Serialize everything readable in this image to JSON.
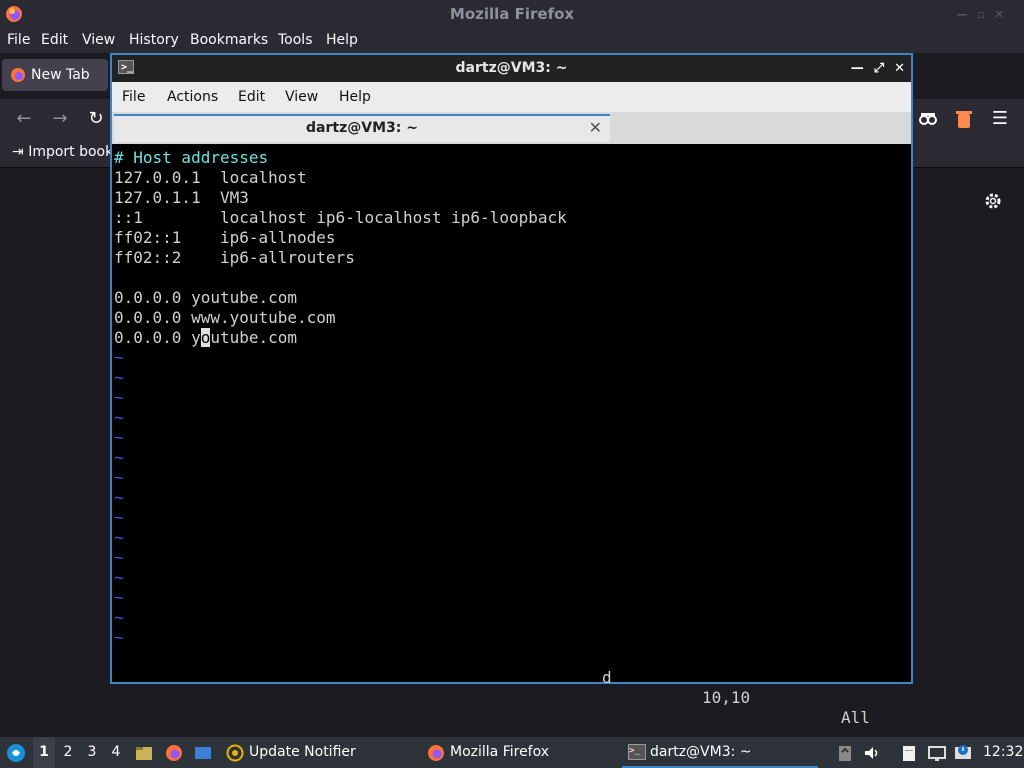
{
  "firefox": {
    "window_title": "Mozilla Firefox",
    "menu": [
      "File",
      "Edit",
      "View",
      "History",
      "Bookmarks",
      "Tools",
      "Help"
    ],
    "tab_label": "New Tab",
    "bookmark_label": "Import book"
  },
  "terminal": {
    "window_title": "dartz@VM3: ~",
    "menu": [
      "File",
      "Actions",
      "Edit",
      "View",
      "Help"
    ],
    "tab_label": "dartz@VM3: ~",
    "lines": [
      "# Host addresses",
      "127.0.0.1  localhost",
      "127.0.1.1  VM3",
      "::1        localhost ip6-localhost ip6-loopback",
      "ff02::1    ip6-allnodes",
      "ff02::2    ip6-allrouters",
      "",
      "0.0.0.0 youtube.com",
      "0.0.0.0 www.youtube.com"
    ],
    "cursor_line": {
      "before": "0.0.0.0 y",
      "cursor_char": "o",
      "after": "utube.com"
    },
    "tilde": "~",
    "status": {
      "pending": "d",
      "position": "10,10",
      "scroll": "All"
    }
  },
  "taskbar": {
    "workspaces": [
      "1",
      "2",
      "3",
      "4"
    ],
    "apps": [
      "Update Notifier",
      "Mozilla Firefox",
      "dartz@VM3: ~"
    ],
    "clock": "12:32"
  },
  "colors": {
    "accent": "#3c86c6",
    "comment": "#6ee0e0",
    "tilde": "#4a56d6"
  }
}
